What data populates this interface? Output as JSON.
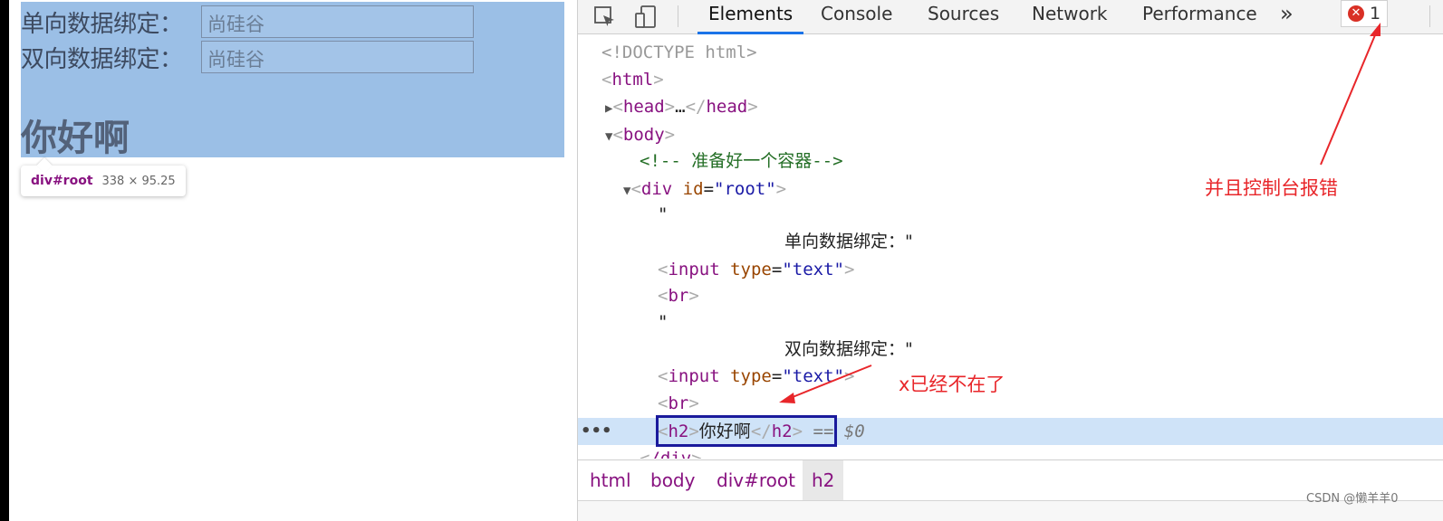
{
  "preview": {
    "rows": [
      {
        "label": "单向数据绑定：",
        "value": "尚硅谷"
      },
      {
        "label": "双向数据绑定：",
        "value": "尚硅谷"
      }
    ],
    "heading": "你好啊",
    "tooltip": {
      "tag": "div#root",
      "size": "338 × 95.25"
    }
  },
  "devtools": {
    "tabs": [
      "Elements",
      "Console",
      "Sources",
      "Network",
      "Performance"
    ],
    "more_tabs": "»",
    "error_count": "1",
    "dom": {
      "doctype": "<!DOCTYPE html>",
      "html_open": "html",
      "head": "head",
      "head_ellipsis": "…",
      "body_open": "body",
      "comment": "<!-- 准备好一个容器-->",
      "div_tag": "div",
      "div_attr": "id",
      "div_val": "\"root\"",
      "quote": "\"",
      "text1": "单向数据绑定：\"",
      "text2": "双向数据绑定：\"",
      "input_tag": "input",
      "input_attr": "type",
      "input_val": "\"text\"",
      "br_tag": "br",
      "h2_tag": "h2",
      "h2_text": "你好啊",
      "selected_marker": "== $0",
      "div_close": "/div"
    },
    "breadcrumbs": [
      "html",
      "body",
      "div#root",
      "h2"
    ]
  },
  "annotations": {
    "console_error": "并且控制台报错",
    "x_gone": "x已经不在了"
  },
  "watermark": "CSDN @懒羊羊0",
  "colors": {
    "highlight": "#9bbfe6",
    "annotation": "#e8262a",
    "selection": "#1a1a9c",
    "accent": "#1a73e8"
  }
}
